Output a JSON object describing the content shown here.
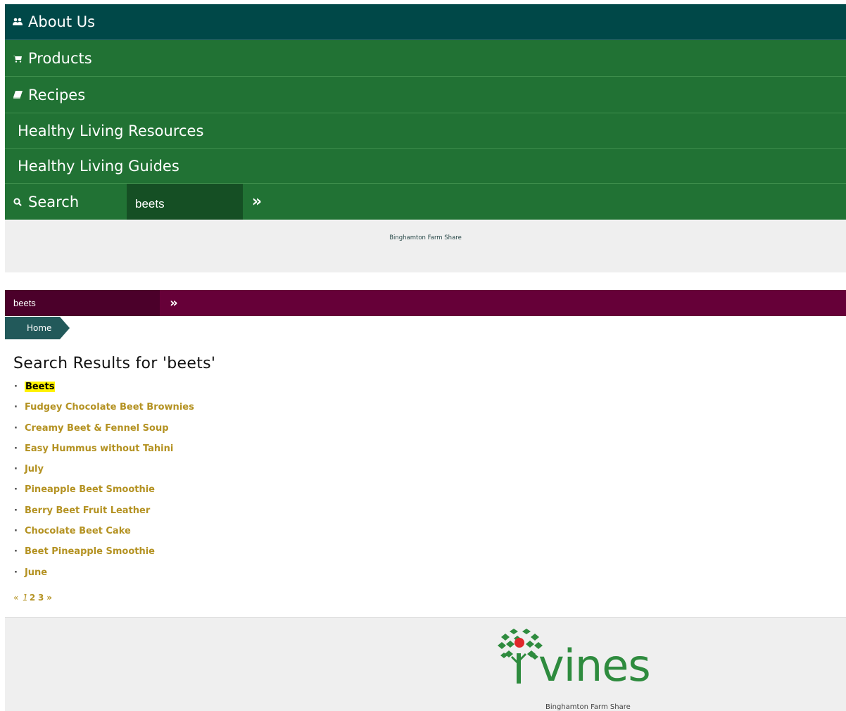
{
  "nav": {
    "about_label": "About Us",
    "products_label": "Products",
    "recipes_label": "Recipes",
    "resources_label": "Healthy Living Resources",
    "guides_label": "Healthy Living Guides",
    "search_label": "Search",
    "search_value": "beets",
    "search_go": "»"
  },
  "header": {
    "brand": "Binghamton Farm Share"
  },
  "secondary_search": {
    "value": "beets",
    "go": "»"
  },
  "breadcrumb": {
    "home": "Home"
  },
  "results": {
    "title": "Search Results for 'beets'",
    "items": [
      "Beets",
      "Fudgey Chocolate Beet Brownies",
      "Creamy Beet & Fennel Soup",
      "Easy Hummus without Tahini",
      "July",
      "Pineapple Beet Smoothie",
      "Berry Beet Fruit Leather",
      "Chocolate Beet Cake",
      "Beet Pineapple Smoothie",
      "June"
    ]
  },
  "pagination": {
    "prev": "«",
    "pages": [
      "1",
      "2",
      "3"
    ],
    "next": "»"
  },
  "footer": {
    "logo_text": "vines",
    "brand": "Binghamton Farm Share"
  },
  "colors": {
    "nav_green": "#217234",
    "nav_teal": "#004848",
    "purple": "#660038",
    "link_gold": "#b49222",
    "highlight": "#fff200"
  }
}
